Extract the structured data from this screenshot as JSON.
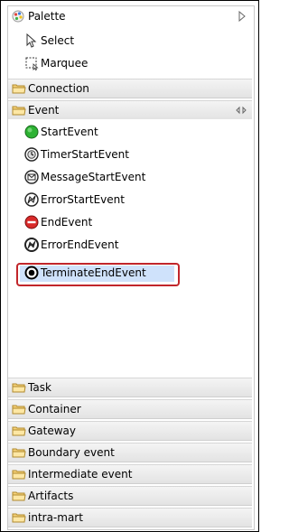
{
  "palette": {
    "title": "Palette"
  },
  "tools": [
    {
      "label": "Select",
      "icon": "arrow-cursor-icon"
    },
    {
      "label": "Marquee",
      "icon": "marquee-icon"
    }
  ],
  "drawers_top": [
    {
      "label": "Connection",
      "icon": "folder-icon"
    },
    {
      "label": "Event",
      "icon": "folder-open-icon"
    }
  ],
  "event_entries": [
    {
      "label": "StartEvent",
      "icon": "start-event-icon"
    },
    {
      "label": "TimerStartEvent",
      "icon": "timer-start-event-icon"
    },
    {
      "label": "MessageStartEvent",
      "icon": "message-start-event-icon"
    },
    {
      "label": "ErrorStartEvent",
      "icon": "error-start-event-icon"
    },
    {
      "label": "EndEvent",
      "icon": "end-event-icon"
    },
    {
      "label": "ErrorEndEvent",
      "icon": "error-end-event-icon"
    },
    {
      "label": "TerminateEndEvent",
      "icon": "terminate-end-event-icon"
    }
  ],
  "drawers_bottom": [
    {
      "label": "Task"
    },
    {
      "label": "Container"
    },
    {
      "label": "Gateway"
    },
    {
      "label": "Boundary event"
    },
    {
      "label": "Intermediate event"
    },
    {
      "label": "Artifacts"
    },
    {
      "label": "intra-mart"
    }
  ],
  "colors": {
    "selected_border": "#c1262b",
    "selected_fill": "#cfe2fb",
    "start_green": "#2db233",
    "end_red": "#d92a2a"
  }
}
